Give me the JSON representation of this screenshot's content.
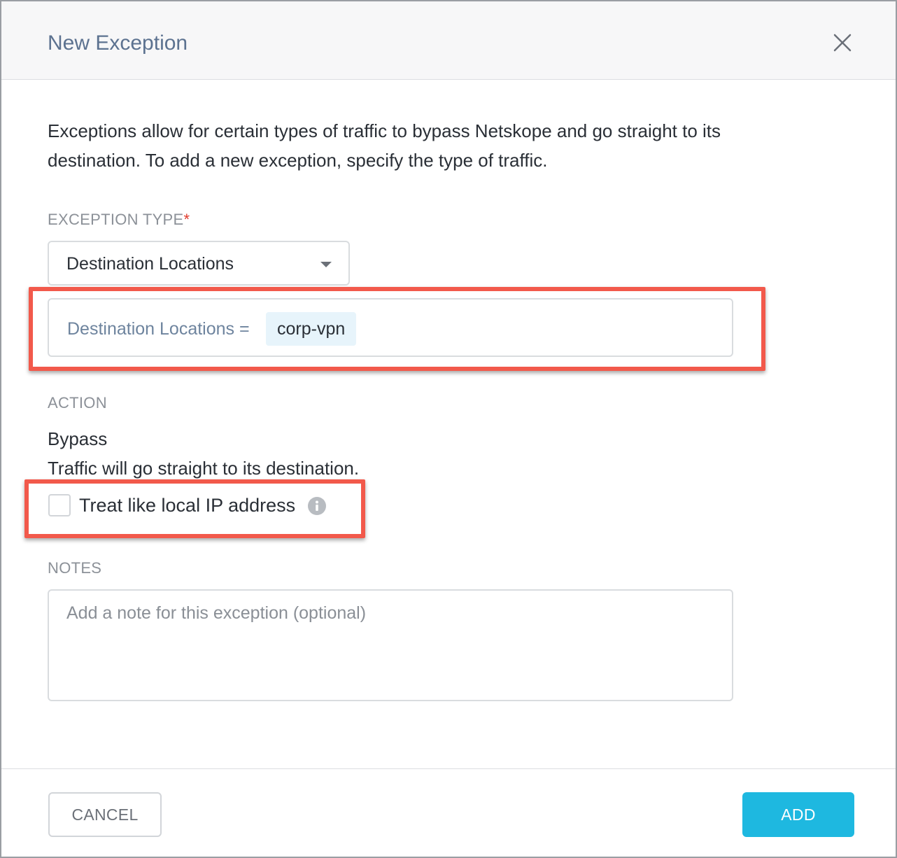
{
  "dialog": {
    "title": "New Exception",
    "description": "Exceptions allow for certain types of traffic to bypass Netskope and go straight to its destination. To add a new exception, specify the type of traffic."
  },
  "exception_type": {
    "label": "EXCEPTION TYPE",
    "required_marker": "*",
    "selected": "Destination Locations"
  },
  "destination": {
    "label": "Destination Locations =",
    "chips": [
      "corp-vpn"
    ]
  },
  "action": {
    "label": "ACTION",
    "name": "Bypass",
    "description": "Traffic will go straight to its destination.",
    "checkbox_label": "Treat like local IP address",
    "checkbox_checked": false
  },
  "notes": {
    "label": "NOTES",
    "placeholder": "Add a note for this exception (optional)",
    "value": ""
  },
  "footer": {
    "cancel_label": "CANCEL",
    "add_label": "ADD"
  },
  "icons": {
    "close": "close-icon",
    "caret": "chevron-down-icon",
    "info": "info-icon"
  },
  "colors": {
    "title": "#5c7290",
    "primary": "#1eb8e0",
    "highlight": "#f2594b",
    "required": "#e0392b",
    "chip_bg": "#e7f4fb"
  }
}
